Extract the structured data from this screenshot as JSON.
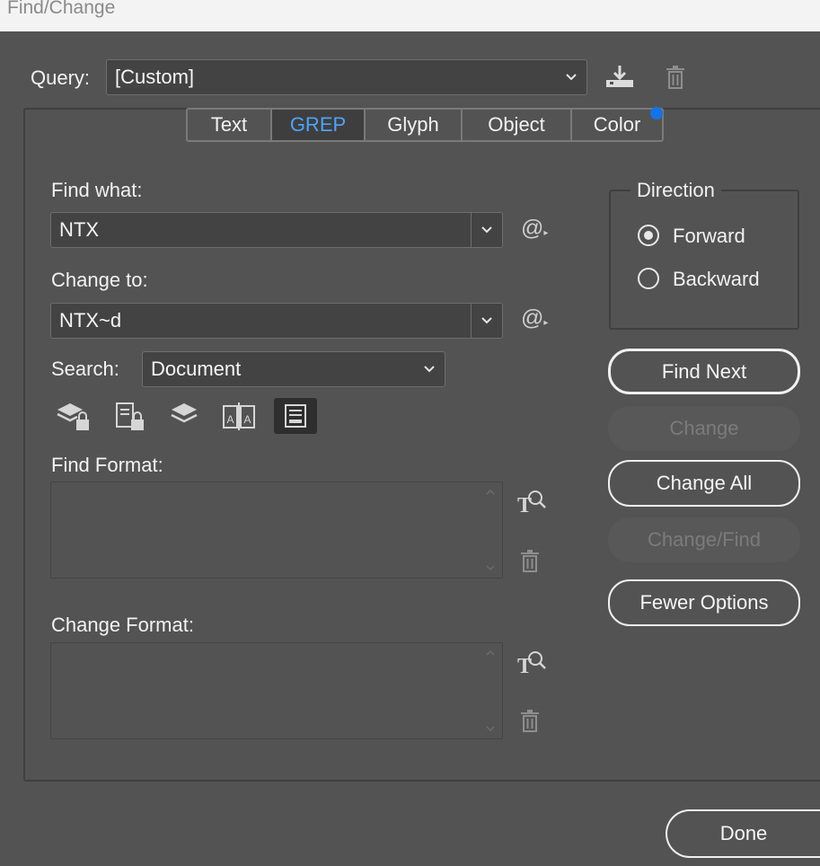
{
  "window": {
    "title": "Find/Change"
  },
  "query": {
    "label": "Query:",
    "value": "[Custom]",
    "save_icon": "save-query-icon",
    "delete_icon": "trash-icon"
  },
  "tabs": [
    {
      "label": "Text",
      "active": false
    },
    {
      "label": "GREP",
      "active": true
    },
    {
      "label": "Glyph",
      "active": false
    },
    {
      "label": "Object",
      "active": false
    },
    {
      "label": "Color",
      "active": false
    }
  ],
  "find_what": {
    "label": "Find what:",
    "value": "NTX"
  },
  "change_to": {
    "label": "Change to:",
    "value": "NTX~d"
  },
  "search": {
    "label": "Search:",
    "value": "Document"
  },
  "option_icons": [
    "include-locked-layers-icon",
    "include-locked-stories-icon",
    "include-hidden-layers-icon",
    "include-master-pages-icon",
    "include-footnotes-icon"
  ],
  "find_format": {
    "label": "Find Format:"
  },
  "change_format": {
    "label": "Change Format:"
  },
  "direction": {
    "legend": "Direction",
    "forward": "Forward",
    "backward": "Backward",
    "selected": "Forward"
  },
  "buttons": {
    "find_next": "Find Next",
    "change": "Change",
    "change_all": "Change All",
    "change_find": "Change/Find",
    "fewer_options": "Fewer Options",
    "done": "Done"
  },
  "colors": {
    "accent": "#4fa3f7",
    "notification": "#1473e6",
    "background": "#535353"
  }
}
